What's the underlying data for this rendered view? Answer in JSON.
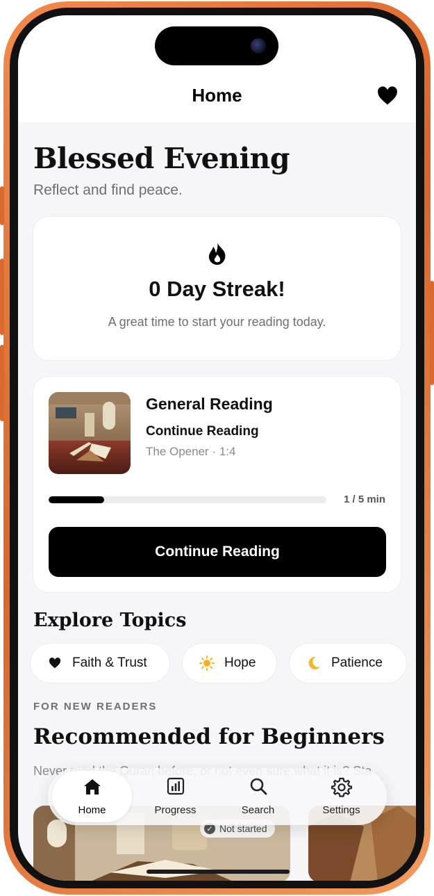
{
  "header": {
    "title": "Home"
  },
  "greeting": {
    "title": "Blessed Evening",
    "subtitle": "Reflect and find peace."
  },
  "streak": {
    "title": "0 Day Streak!",
    "subtitle": "A great time to start your reading today."
  },
  "reading": {
    "title": "General Reading",
    "action": "Continue Reading",
    "meta": "The Opener · 1:4",
    "progress_label": "1 / 5 min",
    "progress_fraction": 0.2,
    "button_label": "Continue Reading"
  },
  "topics": {
    "title": "Explore Topics",
    "chips": [
      {
        "label": "Faith & Trust",
        "icon": "heart-icon"
      },
      {
        "label": "Hope",
        "icon": "sun-icon"
      },
      {
        "label": "Patience",
        "icon": "moon-icon"
      }
    ]
  },
  "recommended": {
    "eyebrow": "FOR NEW READERS",
    "title": "Recommended for Beginners",
    "description": "Never read the Quran before, or not even sure what it is? Sta",
    "status": "Not started"
  },
  "tabbar": {
    "tabs": [
      {
        "label": "Home",
        "icon": "home-icon",
        "active": true
      },
      {
        "label": "Progress",
        "icon": "chart-icon",
        "active": false
      },
      {
        "label": "Search",
        "icon": "search-icon",
        "active": false
      },
      {
        "label": "Settings",
        "icon": "gear-icon",
        "active": false
      }
    ]
  },
  "colors": {
    "accent": "#000000",
    "background": "#f6f6f8",
    "frame": "#e87a3e"
  }
}
